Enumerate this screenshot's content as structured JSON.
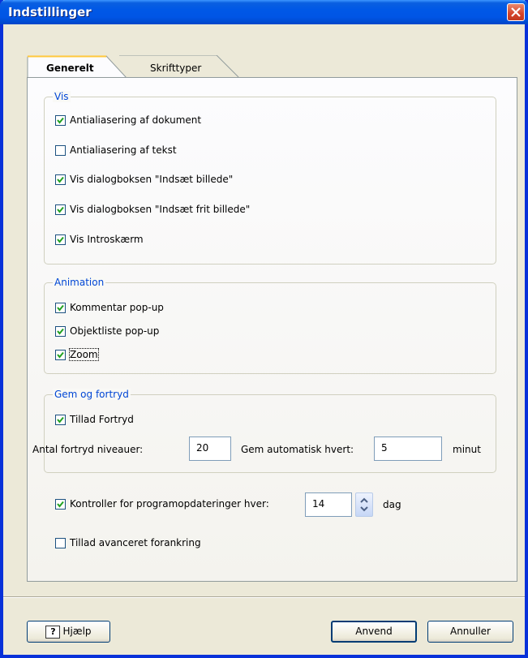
{
  "window": {
    "title": "Indstillinger"
  },
  "tabs": [
    {
      "label": "Generelt",
      "active": true
    },
    {
      "label": "Skrifttyper",
      "active": false
    }
  ],
  "vis": {
    "title": "Vis",
    "items": [
      {
        "label": "Antialiasering af dokument",
        "checked": true
      },
      {
        "label": "Antialiasering af tekst",
        "checked": false
      },
      {
        "label": "Vis dialogboksen \"Indsæt billede\"",
        "checked": true
      },
      {
        "label": "Vis dialogboksen \"Indsæt frit billede\"",
        "checked": true
      },
      {
        "label": "Vis Introskærm",
        "checked": true
      }
    ]
  },
  "animation": {
    "title": "Animation",
    "items": [
      {
        "label": "Kommentar pop-up",
        "checked": true
      },
      {
        "label": "Objektliste pop-up",
        "checked": true
      },
      {
        "label": "Zoom",
        "checked": true
      }
    ]
  },
  "gem": {
    "title": "Gem og fortryd",
    "allow_undo": {
      "label": "Tillad Fortryd",
      "checked": true
    },
    "undo_levels_label": "Antal fortryd niveauer:",
    "undo_levels_value": "20",
    "autosave_label": "Gem automatisk hvert:",
    "autosave_value": "5",
    "autosave_unit": "minut"
  },
  "updates": {
    "label": "Kontroller for programopdateringer hver:",
    "checked": true,
    "value": "14",
    "unit": "dag"
  },
  "advanced_docking": {
    "label": "Tillad avanceret forankring",
    "checked": false
  },
  "buttons": {
    "help": "Hjælp",
    "apply": "Anvend",
    "cancel": "Annuller"
  },
  "colors": {
    "titlebar": "#0055e5",
    "group_title": "#0046d5",
    "window_bg": "#ece9d8",
    "close": "#d4432a"
  }
}
